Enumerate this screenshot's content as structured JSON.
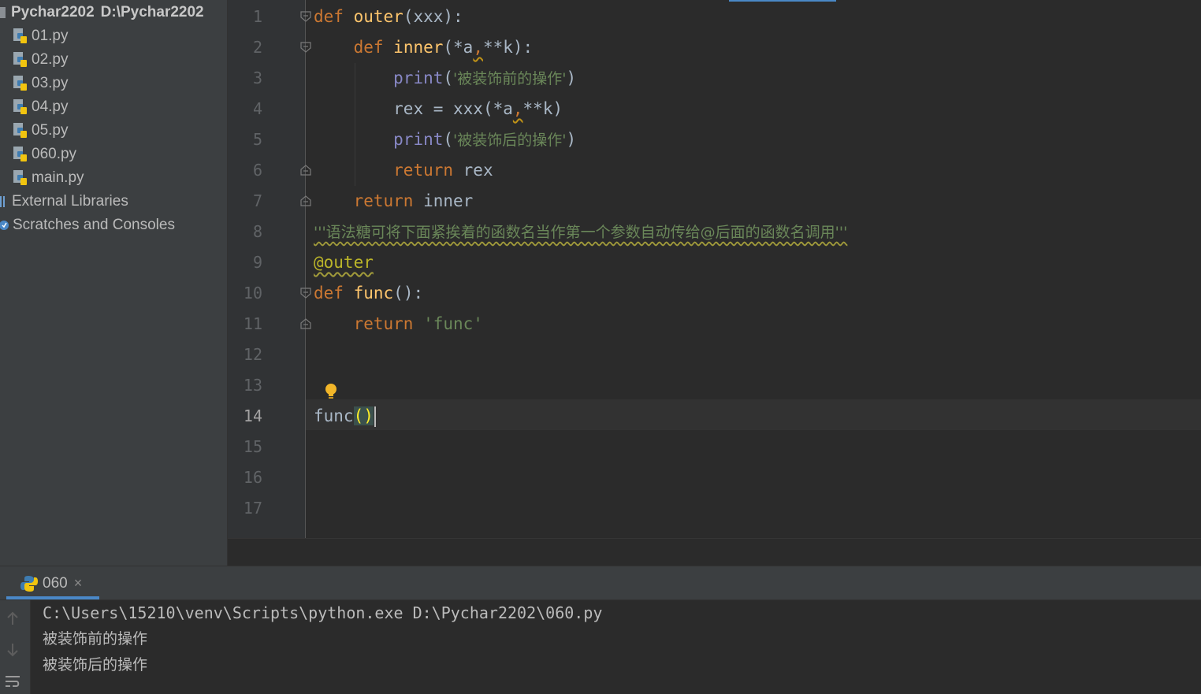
{
  "sidebar": {
    "project_name": "Pychar2202",
    "project_path": "D:\\Pychar2202",
    "files": [
      "01.py",
      "02.py",
      "03.py",
      "04.py",
      "05.py",
      "060.py",
      "main.py"
    ],
    "external_libraries": "External Libraries",
    "scratches": "Scratches and Consoles"
  },
  "editor": {
    "line_numbers": [
      "1",
      "2",
      "3",
      "4",
      "5",
      "6",
      "7",
      "8",
      "9",
      "10",
      "11",
      "12",
      "13",
      "14",
      "15",
      "16",
      "17"
    ],
    "current_line": "14",
    "tokens": {
      "def": "def",
      "outer": "outer",
      "outer_params": "(xxx):",
      "inner": "inner",
      "inner_open": "(*a",
      "comma": ",",
      "inner_close": "**k):",
      "print": "print",
      "paren_open": "(",
      "str_before": "'被装饰前的操作'",
      "paren_close": ")",
      "rex_assign": "rex = xxx(*a",
      "rex_close": "**k)",
      "str_after": "'被装饰后的操作'",
      "return": "return",
      "rex": " rex",
      "inner_ret": " inner",
      "docstring": "'''语法糖可将下面紧挨着的函数名当作第一个参数自动传给@后面的函数名调用'''",
      "decorator": "@outer",
      "func": "func",
      "func_sig": "():",
      "func_ret": " 'func'",
      "call_name": "func",
      "call_parens": "()"
    }
  },
  "run_panel": {
    "tab_label": "060",
    "close_glyph": "×",
    "output": [
      "C:\\Users\\15210\\venv\\Scripts\\python.exe D:\\Pychar2202\\060.py",
      "被装饰前的操作",
      "被装饰后的操作"
    ]
  },
  "colors": {
    "keyword": "#cc7832",
    "function": "#ffc66d",
    "builtin": "#8888c6",
    "string": "#6a8759",
    "decorator": "#bbb529",
    "text": "#a9b7c6",
    "accent": "#4a88c7"
  },
  "icons": [
    "python-file-icon",
    "fold-marker-icon",
    "lightbulb-icon",
    "arrow-up-icon",
    "arrow-down-icon",
    "soft-wrap-icon",
    "python-icon",
    "close-icon"
  ]
}
